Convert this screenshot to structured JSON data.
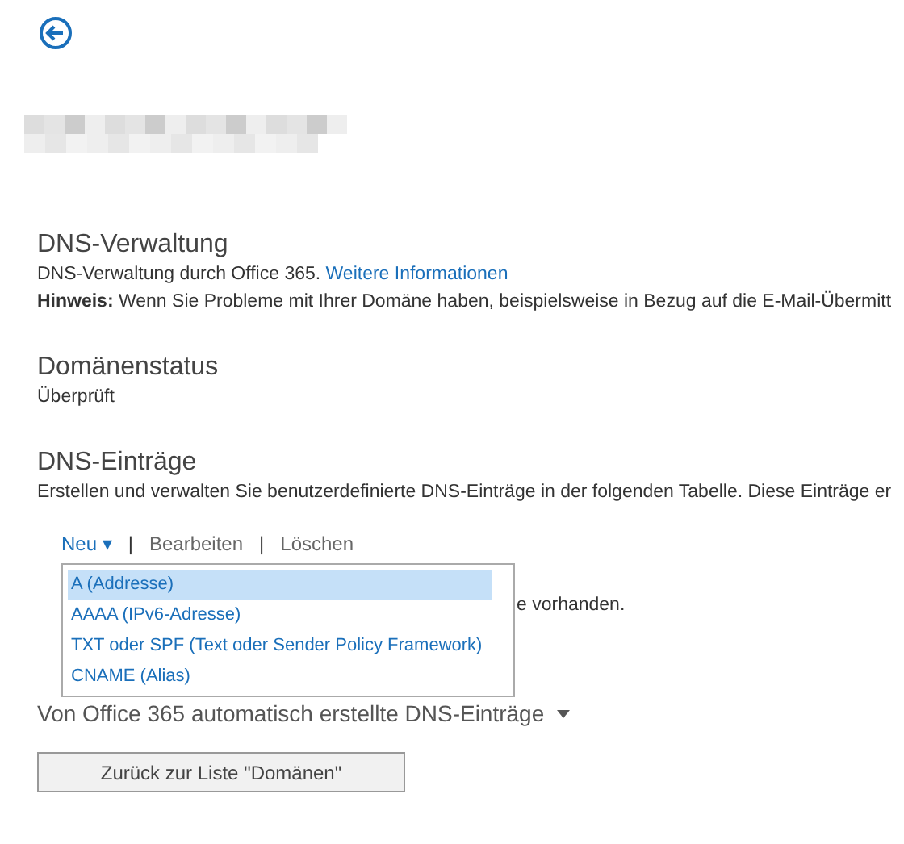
{
  "sections": [
    {
      "heading": "DNS-Verwaltung",
      "text": "DNS-Verwaltung durch Office 365.",
      "link": "Weitere Informationen",
      "note": "**Hinweis:** Wenn Sie Probleme mit Ihrer Domäne haben, beispielsweise in Bezug auf die E-Mail-Übermitt"
    },
    {
      "heading": "Domänenstatus",
      "text": "Überprüft"
    },
    {
      "heading": "DNS-Einträge",
      "text": "Erstellen und verwalten Sie benutzerdefinierte DNS-Einträge in der folgenden Tabelle. Diese Einträge er"
    }
  ],
  "toolbar": [
    {
      "label": "Neu",
      "caret": "▾",
      "disabled": false,
      "expanded": true
    },
    {
      "separator": "|",
      "label": "Bearbeiten",
      "disabled": true
    },
    {
      "separator": "|",
      "label": "Löschen",
      "disabled": true
    }
  ],
  "menu": [
    {
      "label": "A (Addresse)",
      "selected": true
    },
    {
      "label": "AAAA (IPv6-Adresse)",
      "selected": false
    },
    {
      "label": "TXT oder SPF (Text oder Sender Policy Framework)",
      "selected": false
    },
    {
      "label": "CNAME (Alias)",
      "selected": false
    }
  ],
  "empty_text": "e vorhanden.",
  "auto_records": {
    "label": "Von Office 365 automatisch erstellte DNS-Einträge",
    "expanded": false
  },
  "back_list_button": "Zurück zur Liste \"Domänen\""
}
